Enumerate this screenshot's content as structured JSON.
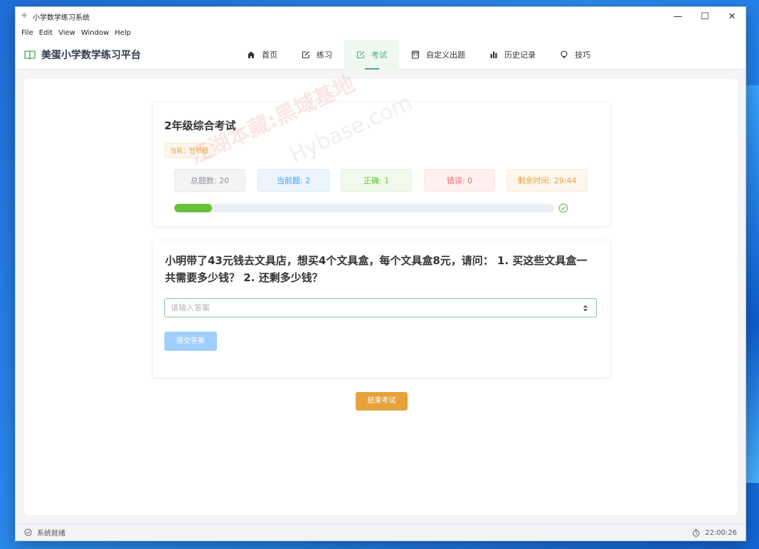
{
  "window": {
    "title": "小学数学练习系统",
    "controls": {
      "minimize": "—",
      "maximize": "☐",
      "close": "✕"
    }
  },
  "menu": [
    "File",
    "Edit",
    "View",
    "Window",
    "Help"
  ],
  "nav": {
    "brand": "美蛋小学数学练习平台",
    "tabs": [
      {
        "label": "首页",
        "icon": "home-icon"
      },
      {
        "label": "练习",
        "icon": "edit-icon"
      },
      {
        "label": "考试",
        "icon": "edit-icon"
      },
      {
        "label": "自定义出题",
        "icon": "calculator-icon"
      },
      {
        "label": "历史记录",
        "icon": "bar-chart-icon"
      },
      {
        "label": "技巧",
        "icon": "lightbulb-icon"
      }
    ],
    "active_tab": "考试"
  },
  "exam": {
    "title": "2年级综合考试",
    "current_type": "当前：分析题",
    "stats": {
      "total": "总题数: 20",
      "current": "当前题: 2",
      "correct": "正确: 1",
      "wrong": "错误: 0",
      "time_left": "剩余时间: 29:44"
    },
    "progress_fraction": 0.1
  },
  "question": {
    "text": "小明带了43元钱去文具店，想买4个文具盒，每个文具盒8元，请问： 1. 买这些文具盒一共需要多少钱？ 2. 还剩多少钱？",
    "answer_placeholder": "请输入答案",
    "submit_label": "提交答案"
  },
  "end_exam_label": "结束考试",
  "status": {
    "left": "系统就绪",
    "time": "22:00:26"
  },
  "watermark": {
    "text1": "江湖本藏:黑域基地",
    "text2": "Hybase.com"
  },
  "colors": {
    "accent": "#4caf6e",
    "primary_light": "#a0cfff",
    "warning": "#e6a23c",
    "success": "#67c23a",
    "danger": "#f56c6c",
    "info": "#409eff"
  }
}
